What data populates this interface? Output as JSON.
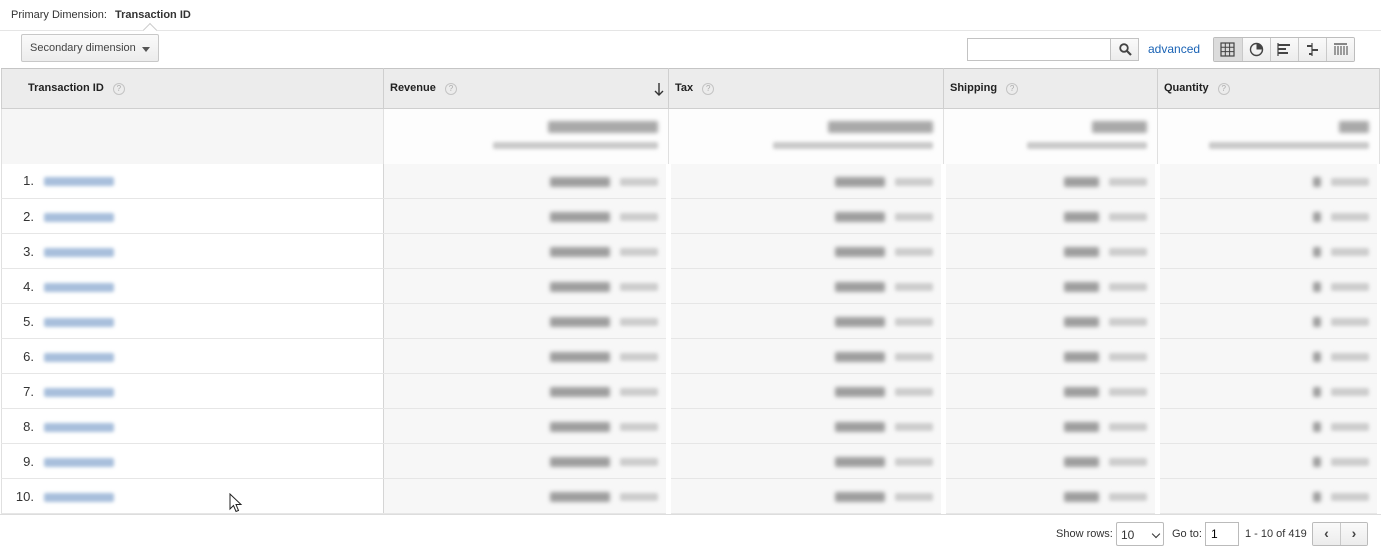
{
  "primary_dimension": {
    "label": "Primary Dimension:",
    "value": "Transaction ID"
  },
  "toolbar": {
    "secondary_dimension_label": "Secondary dimension",
    "search_placeholder": "",
    "advanced_label": "advanced",
    "views": [
      "table-view-icon",
      "pie-view-icon",
      "performance-view-icon",
      "comparison-view-icon",
      "pivot-view-icon"
    ]
  },
  "table": {
    "columns": [
      {
        "label": "Transaction ID",
        "help": "?"
      },
      {
        "label": "Revenue",
        "help": "?",
        "sorted": "desc"
      },
      {
        "label": "Tax",
        "help": "?"
      },
      {
        "label": "Shipping",
        "help": "?"
      },
      {
        "label": "Quantity",
        "help": "?"
      }
    ],
    "rows": [
      {
        "num": "1."
      },
      {
        "num": "2."
      },
      {
        "num": "3."
      },
      {
        "num": "4."
      },
      {
        "num": "5."
      },
      {
        "num": "6."
      },
      {
        "num": "7."
      },
      {
        "num": "8."
      },
      {
        "num": "9."
      },
      {
        "num": "10."
      }
    ]
  },
  "footer": {
    "show_rows_label": "Show rows:",
    "show_rows_value": "10",
    "goto_label": "Go to:",
    "goto_value": "1",
    "range_text": "1 - 10 of 419",
    "prev": "‹",
    "next": "›"
  },
  "colors": {
    "link": "#1a63b5",
    "header_bg": "#ececec",
    "metric_bg": "#f7f7f7"
  }
}
